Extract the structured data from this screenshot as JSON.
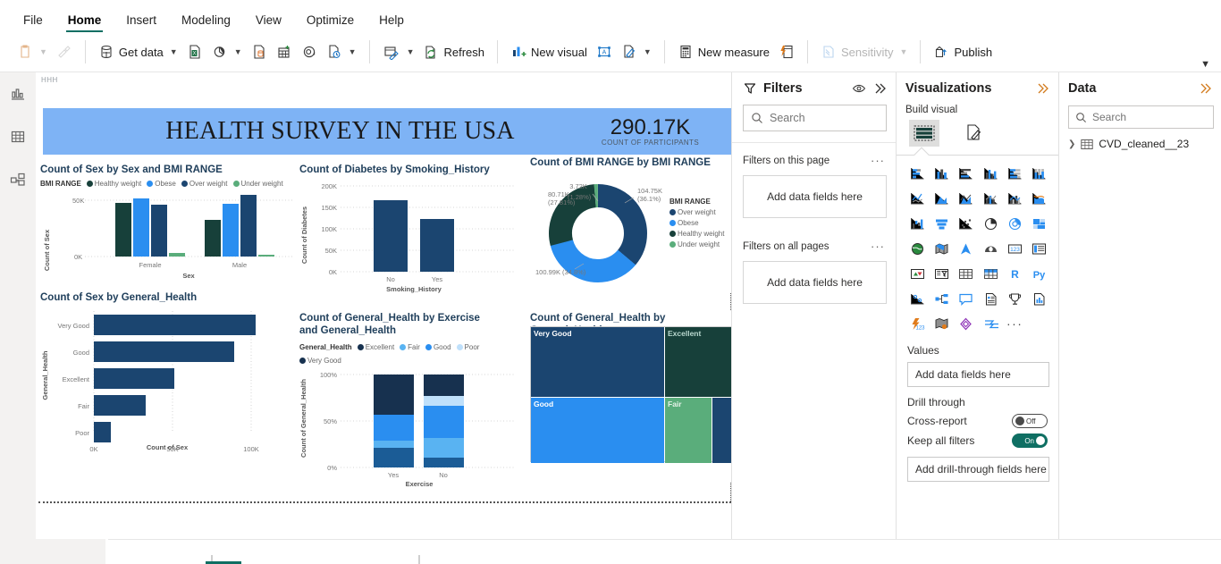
{
  "ribbon": {
    "tabs": [
      {
        "label": "File",
        "active": false
      },
      {
        "label": "Home",
        "active": true
      },
      {
        "label": "Insert",
        "active": false
      },
      {
        "label": "Modeling",
        "active": false
      },
      {
        "label": "View",
        "active": false
      },
      {
        "label": "Optimize",
        "active": false
      },
      {
        "label": "Help",
        "active": false
      }
    ],
    "items": {
      "paste": "",
      "format_painter": "",
      "get_data": "Get data",
      "refresh": "Refresh",
      "new_visual": "New visual",
      "new_measure": "New measure",
      "sensitivity": "Sensitivity",
      "publish": "Publish"
    }
  },
  "rail": {
    "items": [
      {
        "name": "report-view",
        "active": true
      },
      {
        "name": "table-view",
        "active": false
      },
      {
        "name": "model-view",
        "active": false
      }
    ]
  },
  "canvas": {
    "page_tag": "HHH",
    "banner": {
      "title": "HEALTH SURVEY IN THE USA",
      "kpi_value": "290.17K",
      "kpi_label": "COUNT OF PARTICIPANTS",
      "bg_color": "#7eb3f5"
    }
  },
  "colors": {
    "healthy_weight": "#17403a",
    "obese": "#2a8ef0",
    "over_weight": "#1b4570",
    "under_weight": "#5aad7b",
    "dark_navy": "#1b4570",
    "excellent": "#17403a",
    "fair": "#5aad7b",
    "good": "#2a8ef0",
    "poor": "#93c9f5",
    "very_good": "#17314f",
    "teal_accent": "#0f6f63"
  },
  "chart_data": [
    {
      "id": "bmi-by-sex",
      "type": "bar",
      "title": "Count of Sex by Sex and BMI RANGE",
      "legend_caption": "BMI RANGE",
      "legend_position": "top",
      "categories": [
        "Female",
        "Male"
      ],
      "series": [
        {
          "name": "Healthy weight",
          "color": "#17403a",
          "values": [
            49500,
            33500
          ]
        },
        {
          "name": "Obese",
          "color": "#2a8ef0",
          "values": [
            53500,
            48500
          ]
        },
        {
          "name": "Over weight",
          "color": "#1b4570",
          "values": [
            47500,
            57000
          ]
        },
        {
          "name": "Under weight",
          "color": "#5aad7b",
          "values": [
            2800,
            900
          ]
        }
      ],
      "xlabel": "Sex",
      "ylabel": "Count of Sex",
      "yticks": [
        "0K",
        "50K"
      ],
      "ylim": [
        0,
        62000
      ],
      "grid": true
    },
    {
      "id": "diabetes-by-smoking",
      "type": "bar",
      "title": "Count of Diabetes by Smoking_History",
      "categories": [
        "No",
        "Yes"
      ],
      "values": [
        167000,
        123000
      ],
      "color": "#1b4570",
      "xlabel": "Smoking_History",
      "ylabel": "Count of Diabetes",
      "yticks": [
        "0K",
        "50K",
        "100K",
        "150K",
        "200K"
      ],
      "ylim": [
        0,
        200000
      ],
      "grid": true
    },
    {
      "id": "bmi-donut",
      "type": "pie",
      "title": "Count of BMI RANGE by BMI RANGE",
      "legend_caption": "BMI RANGE",
      "legend_position": "right",
      "labels": [
        "Over weight",
        "Obese",
        "Healthy weight",
        "Under weight"
      ],
      "values": [
        104750,
        100990,
        80710,
        3720
      ],
      "value_labels": [
        "104.75K (36.1%)",
        "100.99K (34.8%)",
        "80.71K (27.81%)",
        "3.72K (1.28%)"
      ],
      "percents": [
        36.1,
        34.8,
        27.81,
        1.28
      ],
      "colors": [
        "#1b4570",
        "#2a8ef0",
        "#17403a",
        "#5aad7b"
      ]
    },
    {
      "id": "sex-by-general-health",
      "type": "bar",
      "orientation": "horizontal",
      "title": "Count of Sex by General_Health",
      "categories": [
        "Very Good",
        "Good",
        "Excellent",
        "Fair",
        "Poor"
      ],
      "values": [
        103000,
        89000,
        51000,
        33000,
        11000
      ],
      "color": "#1b4570",
      "xlabel": "Count of Sex",
      "ylabel": "General_Health",
      "xticks": [
        "0K",
        "50K",
        "100K"
      ],
      "xlim": [
        0,
        118000
      ],
      "grid": true
    },
    {
      "id": "health-by-exercise",
      "type": "bar",
      "stacked": "100%",
      "title": "Count of General_Health by Exercise and General_Health",
      "legend_caption": "General_Health",
      "legend_position": "top",
      "categories": [
        "Yes",
        "No"
      ],
      "series": [
        {
          "name": "Excellent",
          "color": "#17314f",
          "values": [
            21.0,
            6.5
          ]
        },
        {
          "name": "Fair",
          "color": "#93c9f5",
          "values": [
            7.5,
            20.0
          ]
        },
        {
          "name": "Good",
          "color": "#2a8ef0",
          "values": [
            28.0,
            40.0
          ]
        },
        {
          "name": "Poor",
          "color": "#93c9f5",
          "values": [
            0.0,
            10.5
          ]
        },
        {
          "name": "Very Good",
          "color": "#17314f",
          "values": [
            43.5,
            23.0
          ]
        }
      ],
      "xlabel": "Exercise",
      "ylabel": "Count of General_Health",
      "yticks": [
        "0%",
        "50%",
        "100%"
      ],
      "ylim": [
        0,
        100
      ],
      "grid": true
    },
    {
      "id": "health-treemap",
      "type": "treemap",
      "title": "Count of General_Health by General_Health",
      "nodes": [
        {
          "label": "Very Good",
          "color": "#1b4570",
          "value": 103000
        },
        {
          "label": "Excellent",
          "color": "#17403a",
          "value": 51000
        },
        {
          "label": "Good",
          "color": "#2a8ef0",
          "value": 89000
        },
        {
          "label": "Fair",
          "color": "#5aad7b",
          "value": 33000
        },
        {
          "label": "",
          "color": "#1b4570",
          "value": 11000
        }
      ]
    }
  ],
  "filters_pane": {
    "title": "Filters",
    "search_placeholder": "Search",
    "sections": [
      {
        "title": "Filters on this page",
        "dropzone": "Add data fields here",
        "dots": "···"
      },
      {
        "title": "Filters on all pages",
        "dropzone": "Add data fields here",
        "dots": "···"
      }
    ]
  },
  "visualizations_pane": {
    "title": "Visualizations",
    "build_label": "Build visual",
    "values_label": "Values",
    "values_dropzone": "Add data fields here",
    "drill_label": "Drill through",
    "cross_report_label": "Cross-report",
    "cross_report_state": "Off",
    "keep_filters_label": "Keep all filters",
    "keep_filters_state": "On",
    "drill_dropzone": "Add drill-through fields here",
    "icons": [
      "stacked-bar-chart-icon",
      "stacked-column-chart-icon",
      "clustered-bar-chart-icon",
      "clustered-column-chart-icon",
      "100-stacked-bar-chart-icon",
      "100-stacked-column-chart-icon",
      "line-chart-icon",
      "area-chart-icon",
      "stacked-area-chart-icon",
      "line-stacked-column-icon",
      "line-clustered-column-icon",
      "ribbon-chart-icon",
      "waterfall-chart-icon",
      "funnel-chart-icon",
      "scatter-chart-icon",
      "pie-chart-icon",
      "donut-chart-icon",
      "treemap-icon",
      "map-icon",
      "filled-map-icon",
      "azure-map-icon",
      "arcgis-map-icon",
      "card-icon",
      "multi-row-card-icon",
      "kpi-icon",
      "slicer-icon",
      "table-icon",
      "matrix-icon",
      "r-script-visual-icon",
      "python-visual-icon",
      "key-influencers-icon",
      "decomposition-tree-icon",
      "qa-visual-icon",
      "narrative-icon",
      "metrics-icon",
      "paginated-report-icon",
      "power-automate-icon",
      "arcgis-plus-icon",
      "azure-ml-icon",
      "flow-icon",
      "more-options-icon"
    ]
  },
  "data_pane": {
    "title": "Data",
    "search_placeholder": "Search",
    "tables": [
      {
        "name": "CVD_cleaned__23",
        "expanded": false
      }
    ]
  }
}
